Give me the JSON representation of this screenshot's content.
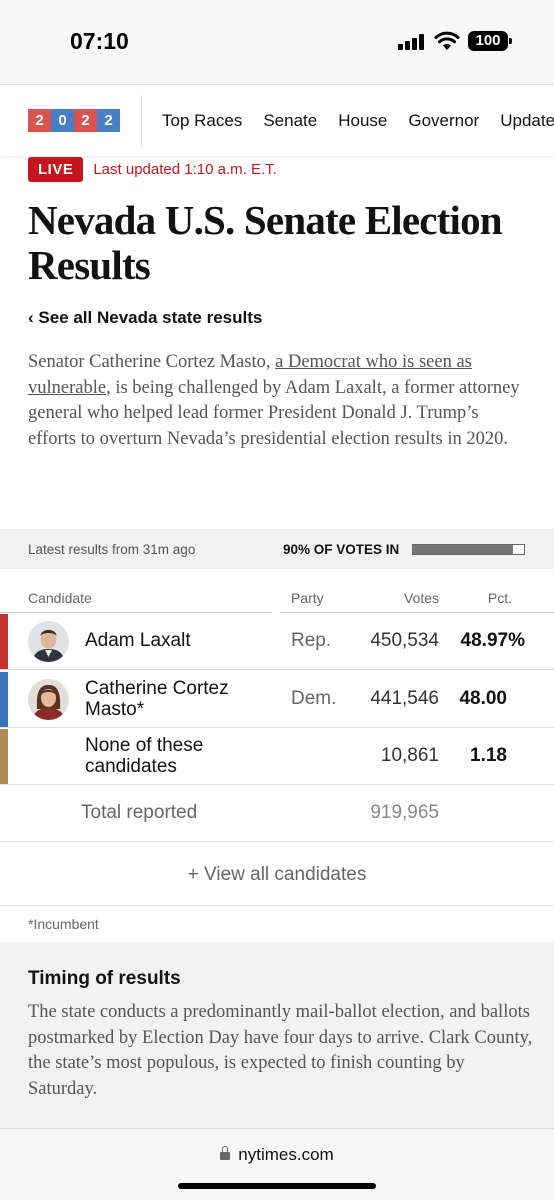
{
  "status_bar": {
    "time": "07:10",
    "battery": "100"
  },
  "nav": {
    "logo_digits": [
      "2",
      "0",
      "2",
      "2"
    ],
    "items": [
      "Top Races",
      "Senate",
      "House",
      "Governor",
      "Updates"
    ]
  },
  "live": {
    "badge": "LIVE",
    "updated": "Last updated 1:10 a.m. E.T."
  },
  "page_title": "Nevada U.S. Senate Election Results",
  "see_all": "‹ See all Nevada state results",
  "summary": {
    "before": "Senator Catherine Cortez Masto, ",
    "link": "a Democrat who is seen as vulnerable",
    "after": ", is being challenged by Adam Laxalt, a former attorney general who helped lead former President Donald J. Trump’s efforts to overturn Nevada’s presidential election results in 2020."
  },
  "results_status": {
    "latest": "Latest results from 31m ago",
    "votes_in": "90% OF VOTES IN",
    "progress_fraction": 0.9
  },
  "table": {
    "headers": {
      "candidate": "Candidate",
      "party": "Party",
      "votes": "Votes",
      "pct": "Pct."
    },
    "rows": [
      {
        "name": "Adam Laxalt",
        "party": "Rep.",
        "votes": "450,534",
        "pct": "48.97%",
        "color": "#c4302b"
      },
      {
        "name": "Catherine Cortez Masto*",
        "party": "Dem.",
        "votes": "441,546",
        "pct": "48.00",
        "color": "#3a74b8"
      },
      {
        "name": "None of these candidates",
        "party": "",
        "votes": "10,861",
        "pct": "1.18",
        "color": "#b08d57"
      }
    ],
    "total_label": "Total reported",
    "total_votes": "919,965"
  },
  "view_all": "+ View all candidates",
  "incumbent_note": "*Incumbent",
  "timing": {
    "title": "Timing of results",
    "body": "The state conducts a predominantly mail-ballot election, and ballots postmarked by Election Day have four days to arrive. Clark County, the state’s most populous, is expected to finish counting by Saturday."
  },
  "url": "nytimes.com"
}
